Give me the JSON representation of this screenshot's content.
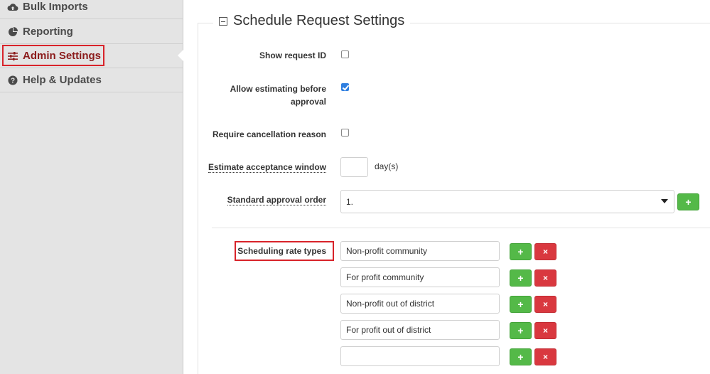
{
  "sidebar": {
    "items": [
      {
        "label": "Bulk Imports",
        "icon": "cloud-upload-icon"
      },
      {
        "label": "Reporting",
        "icon": "pie-chart-icon"
      },
      {
        "label": "Admin Settings",
        "icon": "sliders-icon"
      },
      {
        "label": "Help & Updates",
        "icon": "question-circle-icon"
      }
    ]
  },
  "section": {
    "title": "Schedule Request Settings"
  },
  "settings": {
    "show_request_id": {
      "label": "Show request ID",
      "checked": false
    },
    "allow_estimating": {
      "label_line1": "Allow estimating before",
      "label_line2": "approval",
      "checked": true
    },
    "require_cancellation": {
      "label": "Require cancellation reason",
      "checked": false
    },
    "estimate_window": {
      "label": "Estimate acceptance window",
      "value": "",
      "unit": "day(s)"
    },
    "approval_order": {
      "label": "Standard approval order",
      "value": "1.",
      "add": "+"
    }
  },
  "rate_types": {
    "label": "Scheduling rate types",
    "items": [
      "Non-profit community",
      "For profit community",
      "Non-profit out of district",
      "For profit out of district",
      ""
    ],
    "add": "+",
    "remove": "×"
  },
  "colors": {
    "active_nav": "#8b1c1c",
    "highlight": "#d8232a",
    "add_button": "#54b948",
    "remove_button": "#d9383f",
    "checkbox_on": "#2f7fe0"
  }
}
